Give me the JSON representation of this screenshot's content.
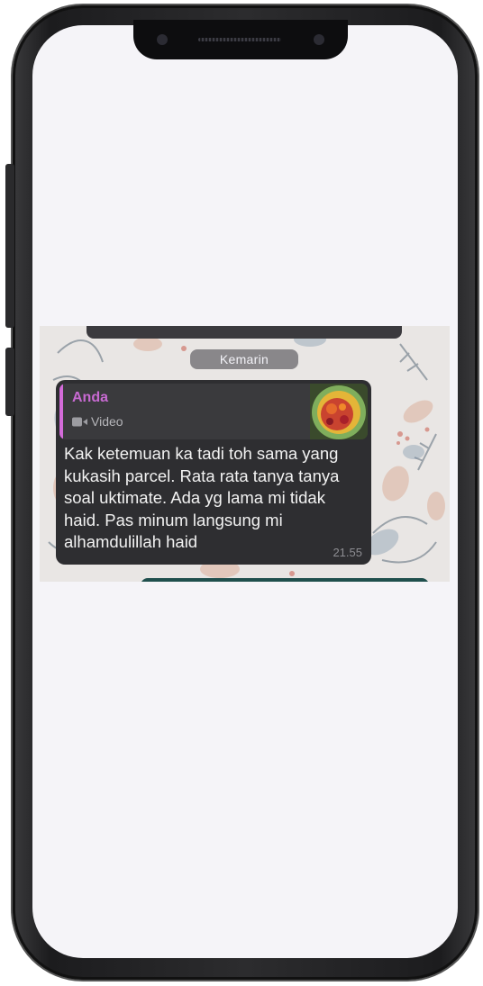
{
  "chat": {
    "date_label": "Kemarin",
    "reply": {
      "author": "Anda",
      "media_icon": "video-camera-icon",
      "media_label": "Video"
    },
    "message": "Kak ketemuan ka tadi toh sama yang kukasih parcel. Rata rata tanya tanya soal uktimate. Ada yg lama mi tidak haid. Pas minum langsung mi alhamdulillah haid",
    "time": "21.55"
  },
  "colors": {
    "bubble": "#2e2e31",
    "reply_accent": "#d36bd9",
    "screen_bg": "#f5f4f8"
  }
}
